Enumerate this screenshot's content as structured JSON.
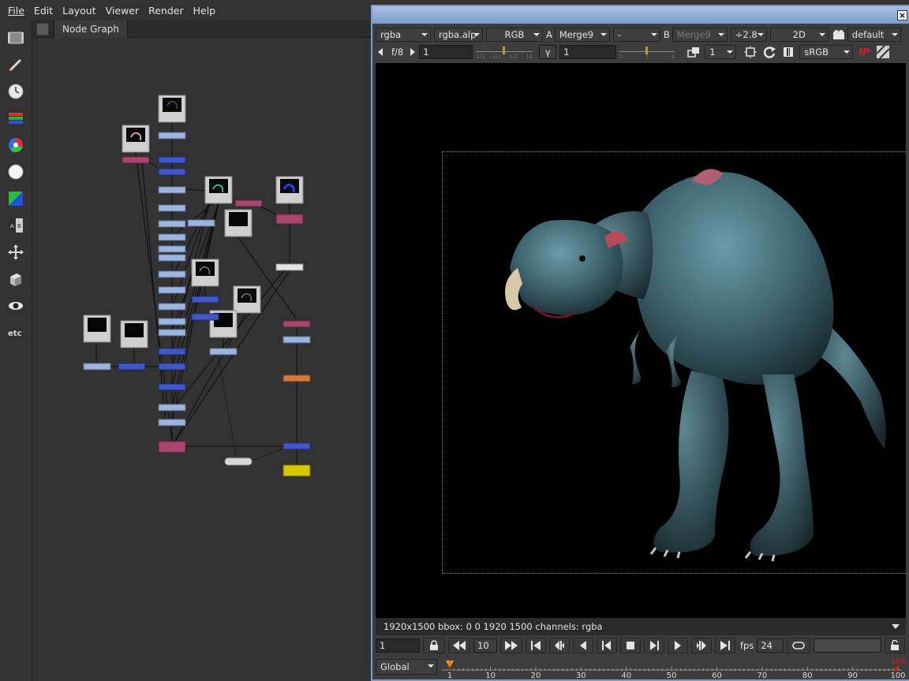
{
  "menu": [
    "File",
    "Edit",
    "Layout",
    "Viewer",
    "Render",
    "Help"
  ],
  "toolbar_tools": [
    "image-icon",
    "draw-icon",
    "time-icon",
    "channel-icon",
    "color-icon",
    "filter-icon",
    "keyer-icon",
    "merge-icon",
    "transform-icon",
    "3d-icon",
    "views-icon",
    "other-icon"
  ],
  "node_graph": {
    "tab_label": "Node Graph"
  },
  "viewer": {
    "row1": {
      "channels": "rgba",
      "layer": "rgba.alp",
      "display": "RGB",
      "a_label": "A",
      "a_input": "Merge9",
      "wipe_mode": "-",
      "b_label": "B",
      "b_input": "Merge9",
      "zoom": "÷2.8",
      "view_mode": "2D",
      "lut": "default"
    },
    "row2": {
      "fstop": "f/8",
      "gain_value": "1",
      "gain_ticks": [
        "1/1",
        "1/1",
        "1/1",
        "16"
      ],
      "gamma_label": "γ",
      "gamma_value": "1",
      "gamma_ticks": [
        "0",
        "1",
        "4"
      ],
      "proxy_value": "1",
      "colorspace": "sRGB",
      "ip_label": "IP"
    },
    "info_text": "1920x1500 bbox: 0 0 1920 1500 channels: rgba",
    "playback": {
      "frame": "1",
      "increment": "10",
      "fps_label": "fps",
      "fps": "24"
    },
    "timeline": {
      "range_mode": "Global",
      "labels": [
        "1",
        "10",
        "20",
        "30",
        "40",
        "50",
        "60",
        "70",
        "80",
        "90",
        "100"
      ],
      "out_marker": "100",
      "current_frame": 1
    }
  },
  "colors": {
    "bg": "#323232",
    "viewer_border": "#7b9ac8",
    "node_light_blue": "#9cb4e0",
    "node_blue": "#3f57c8",
    "node_magenta": "#a8466e",
    "node_orange": "#d57a3c",
    "node_yellow": "#d6c800",
    "ip_red": "#e01818"
  }
}
